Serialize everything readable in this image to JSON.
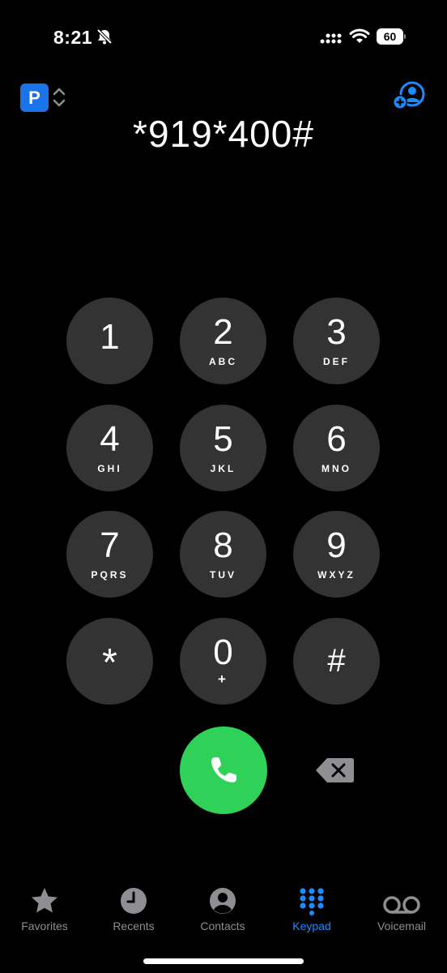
{
  "status": {
    "time": "8:21",
    "battery": "60",
    "icons": [
      "bell-slash-icon",
      "cellular-signal-icon",
      "wifi-icon",
      "battery-icon"
    ]
  },
  "header": {
    "sim_label": "P",
    "icons": [
      "sim-switch-chevron-icon",
      "add-contact-icon"
    ]
  },
  "dialer": {
    "number": "*919*400#"
  },
  "keypad": {
    "keys": [
      {
        "digit": "1",
        "letters": ""
      },
      {
        "digit": "2",
        "letters": "ABC"
      },
      {
        "digit": "3",
        "letters": "DEF"
      },
      {
        "digit": "4",
        "letters": "GHI"
      },
      {
        "digit": "5",
        "letters": "JKL"
      },
      {
        "digit": "6",
        "letters": "MNO"
      },
      {
        "digit": "7",
        "letters": "PQRS"
      },
      {
        "digit": "8",
        "letters": "TUV"
      },
      {
        "digit": "9",
        "letters": "WXYZ"
      },
      {
        "digit": "*",
        "letters": ""
      },
      {
        "digit": "0",
        "letters": "+"
      },
      {
        "digit": "#",
        "letters": ""
      }
    ]
  },
  "actions": {
    "icons": [
      "phone-icon",
      "delete-icon"
    ]
  },
  "tabs": [
    {
      "label": "Favorites",
      "icon": "star-icon",
      "active": false
    },
    {
      "label": "Recents",
      "icon": "clock-icon",
      "active": false
    },
    {
      "label": "Contacts",
      "icon": "person-circle-icon",
      "active": false
    },
    {
      "label": "Keypad",
      "icon": "keypad-grid-icon",
      "active": true
    },
    {
      "label": "Voicemail",
      "icon": "voicemail-icon",
      "active": false
    }
  ],
  "colors": {
    "background": "#000000",
    "key": "#333333",
    "call": "#30d158",
    "accent": "#1a8cff",
    "inactive": "#8e8e93"
  }
}
